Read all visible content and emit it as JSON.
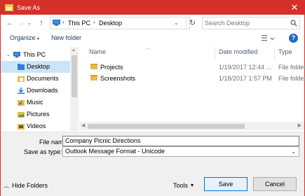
{
  "window": {
    "title": "Save As",
    "close_glyph": "✕"
  },
  "address": {
    "crumbs": [
      "This PC",
      "Desktop"
    ],
    "separator": "›",
    "search_placeholder": "Search Desktop"
  },
  "toolbar": {
    "organize": "Organize",
    "organize_caret": "▾",
    "new_folder": "New folder",
    "help": "?"
  },
  "nav_tree": [
    {
      "label": "This PC",
      "icon": "computer-icon"
    },
    {
      "label": "Desktop",
      "icon": "desktop-folder-icon",
      "selected": true
    },
    {
      "label": "Documents",
      "icon": "documents-icon"
    },
    {
      "label": "Downloads",
      "icon": "downloads-icon"
    },
    {
      "label": "Music",
      "icon": "music-icon"
    },
    {
      "label": "Pictures",
      "icon": "pictures-icon"
    },
    {
      "label": "Videos",
      "icon": "videos-icon"
    }
  ],
  "columns": {
    "name": "Name",
    "date": "Date modified",
    "type": "Type"
  },
  "files": [
    {
      "name": "Projects",
      "date": "1/19/2017 12:44 ...",
      "type": "File folder"
    },
    {
      "name": "Screenshots",
      "date": "1/18/2017 1:57 PM",
      "type": "File folder"
    }
  ],
  "form": {
    "file_name_label": "File name:",
    "file_name_value": "Company Picnic Directions",
    "save_type_label": "Save as type:",
    "save_type_value": "Outlook Message Format - Unicode"
  },
  "footer": {
    "hide_folders": "Hide Folders",
    "tools": "Tools",
    "save": "Save",
    "cancel": "Cancel"
  },
  "colors": {
    "accent": "#d6302a",
    "selection": "#cce4f7",
    "button_focus": "#0078d7"
  }
}
